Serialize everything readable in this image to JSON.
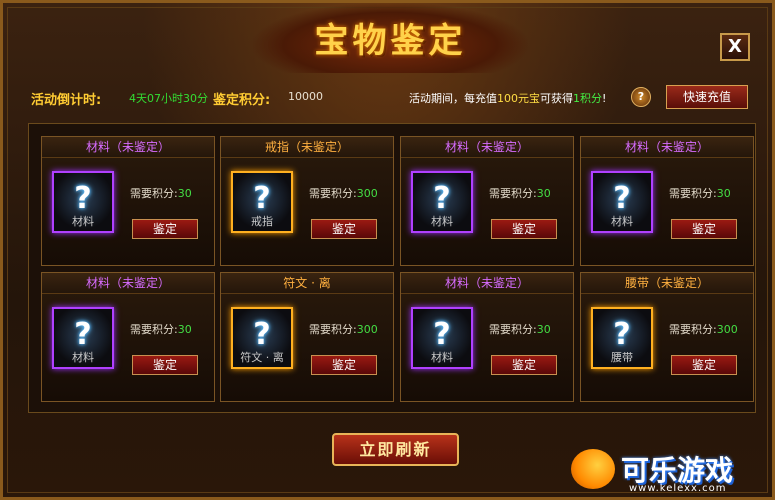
{
  "window": {
    "title": "宝物鉴定",
    "close_label": "X"
  },
  "info": {
    "countdown_label": "活动倒计时:",
    "countdown_value": "4天07小时30分",
    "score_label": "鉴定积分:",
    "score_value": "10000",
    "notice_a": "活动期间，每充值",
    "notice_amount": "100元宝",
    "notice_b": "可获得",
    "notice_points": "1积分",
    "notice_c": "!",
    "help_label": "?",
    "quick_recharge_label": "快速充值"
  },
  "items": [
    {
      "title": "材料（未鉴定）",
      "slot_name": "材料",
      "need_label": "需要积分:",
      "need_value": "30",
      "button": "鉴定",
      "color": "purple"
    },
    {
      "title": "戒指（未鉴定）",
      "slot_name": "戒指",
      "need_label": "需要积分:",
      "need_value": "300",
      "button": "鉴定",
      "color": "gold"
    },
    {
      "title": "材料（未鉴定）",
      "slot_name": "材料",
      "need_label": "需要积分:",
      "need_value": "30",
      "button": "鉴定",
      "color": "purple"
    },
    {
      "title": "材料（未鉴定）",
      "slot_name": "材料",
      "need_label": "需要积分:",
      "need_value": "30",
      "button": "鉴定",
      "color": "purple"
    },
    {
      "title": "材料（未鉴定）",
      "slot_name": "材料",
      "need_label": "需要积分:",
      "need_value": "30",
      "button": "鉴定",
      "color": "purple"
    },
    {
      "title": "符文 · 离",
      "slot_name": "符文 · 离",
      "need_label": "需要积分:",
      "need_value": "300",
      "button": "鉴定",
      "color": "gold"
    },
    {
      "title": "材料（未鉴定）",
      "slot_name": "材料",
      "need_label": "需要积分:",
      "need_value": "30",
      "button": "鉴定",
      "color": "purple"
    },
    {
      "title": "腰带（未鉴定）",
      "slot_name": "腰带",
      "need_label": "需要积分:",
      "need_value": "300",
      "button": "鉴定",
      "color": "gold"
    }
  ],
  "refresh_label": "立即刷新",
  "watermark": {
    "name": "可乐游戏",
    "url": "www.kelexx.com"
  },
  "colors": {
    "purple_quality": "#b040ff",
    "gold_quality": "#ffb020",
    "points_green": "#44dd44"
  }
}
